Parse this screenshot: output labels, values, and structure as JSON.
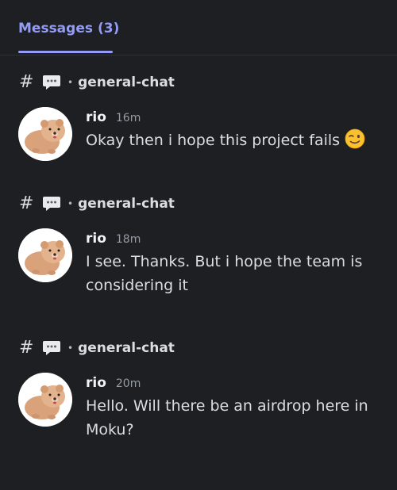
{
  "header": {
    "tab_label": "Messages",
    "tab_count": "(3)"
  },
  "messages": [
    {
      "channel_hash": "#",
      "channel_icon": "speech-bubble-icon",
      "separator": "•",
      "channel": "general-chat",
      "author": "rio",
      "time": "16m",
      "text": "Okay then i hope this project fails",
      "emoji": "winking-face-emoji"
    },
    {
      "channel_hash": "#",
      "channel_icon": "speech-bubble-icon",
      "separator": "•",
      "channel": "general-chat",
      "author": "rio",
      "time": "18m",
      "text": "I see. Thanks. But i hope the team is considering it"
    },
    {
      "channel_hash": "#",
      "channel_icon": "speech-bubble-icon",
      "separator": "•",
      "channel": "general-chat",
      "author": "rio",
      "time": "20m",
      "text": "Hello. Will there be an airdrop here in Moku?"
    }
  ],
  "colors": {
    "background": "#1e1f22",
    "accent": "#949cf7",
    "text": "#dbdee1",
    "muted": "#949ba4"
  }
}
